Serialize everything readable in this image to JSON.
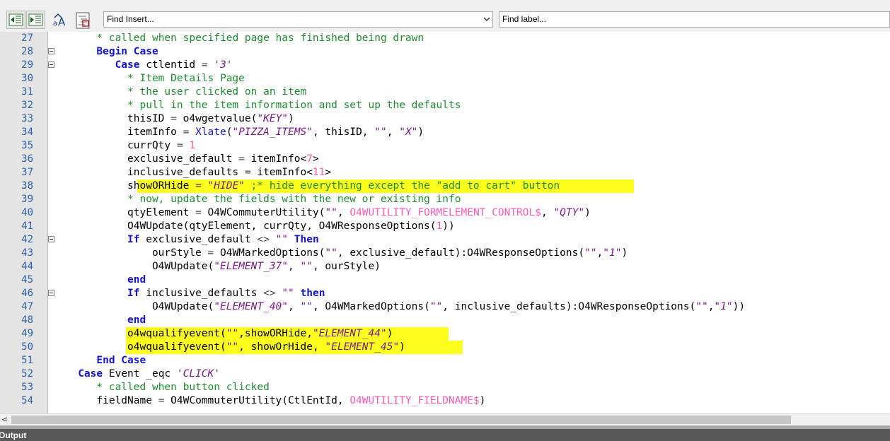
{
  "toolbar": {
    "find_insert_placeholder": "Find Insert...",
    "find_label_placeholder": "Find label...",
    "icons": [
      "outdent-icon",
      "indent-icon",
      "font-size-icon",
      "format-document-icon",
      "chevron-down-icon"
    ]
  },
  "colors": {
    "comment": "#1e8c2e",
    "keyword": "#1414d2",
    "string": "#7a1c88",
    "number": "#ff5ab4",
    "highlight": "#ffff1e",
    "line_number": "#2b5fb4"
  },
  "editor": {
    "lines": [
      {
        "n": "27",
        "fold": false,
        "tokens": [
          [
            "      ",
            ""
          ],
          [
            "* called when specified page has finished being drawn",
            "cm"
          ]
        ]
      },
      {
        "n": "28",
        "fold": true,
        "tokens": [
          [
            "      ",
            ""
          ],
          [
            "Begin Case",
            "kw"
          ]
        ]
      },
      {
        "n": "29",
        "fold": true,
        "tokens": [
          [
            "         ",
            ""
          ],
          [
            "Case",
            "kw"
          ],
          [
            " ctlentid ",
            ""
          ],
          [
            "=",
            "op"
          ],
          [
            " ",
            ""
          ],
          [
            "'3'",
            "str"
          ]
        ]
      },
      {
        "n": "30",
        "fold": false,
        "tokens": [
          [
            "           ",
            ""
          ],
          [
            "* Item Details Page",
            "cm"
          ]
        ]
      },
      {
        "n": "31",
        "fold": false,
        "tokens": [
          [
            "           ",
            ""
          ],
          [
            "* the user clicked on an item",
            "cm"
          ]
        ]
      },
      {
        "n": "32",
        "fold": false,
        "tokens": [
          [
            "           ",
            ""
          ],
          [
            "* pull in the item information and set up the defaults",
            "cm"
          ]
        ]
      },
      {
        "n": "33",
        "fold": false,
        "tokens": [
          [
            "           thisID ",
            ""
          ],
          [
            "=",
            "op"
          ],
          [
            " o4wgetvalue(",
            ""
          ],
          [
            "\"KEY\"",
            "str"
          ],
          [
            ")",
            ""
          ]
        ]
      },
      {
        "n": "34",
        "fold": false,
        "tokens": [
          [
            "           itemInfo ",
            ""
          ],
          [
            "=",
            "op"
          ],
          [
            " ",
            ""
          ],
          [
            "Xlate",
            "kw2"
          ],
          [
            "(",
            ""
          ],
          [
            "\"PIZZA_ITEMS\"",
            "str"
          ],
          [
            ", thisID, ",
            ""
          ],
          [
            "\"\"",
            "str"
          ],
          [
            ", ",
            ""
          ],
          [
            "\"X\"",
            "str"
          ],
          [
            ")",
            ""
          ]
        ]
      },
      {
        "n": "35",
        "fold": false,
        "tokens": [
          [
            "           currQty ",
            ""
          ],
          [
            "=",
            "op"
          ],
          [
            " ",
            ""
          ],
          [
            "1",
            "num"
          ]
        ]
      },
      {
        "n": "36",
        "fold": false,
        "tokens": [
          [
            "           exclusive_default ",
            ""
          ],
          [
            "=",
            "op"
          ],
          [
            " itemInfo<",
            ""
          ],
          [
            "7",
            "num"
          ],
          [
            ">",
            ""
          ]
        ]
      },
      {
        "n": "37",
        "fold": false,
        "tokens": [
          [
            "           inclusive_defaults ",
            ""
          ],
          [
            "=",
            "op"
          ],
          [
            " itemInfo<",
            ""
          ],
          [
            "11",
            "num"
          ],
          [
            ">",
            ""
          ]
        ]
      },
      {
        "n": "38",
        "fold": false,
        "hl": [
          194,
          896
        ],
        "tokens": [
          [
            "           showORHide ",
            ""
          ],
          [
            "=",
            "op"
          ],
          [
            " ",
            ""
          ],
          [
            "\"HIDE\"",
            "str"
          ],
          [
            " ",
            ""
          ],
          [
            ";* hide everything except the \"add to cart\" button",
            "cm"
          ]
        ]
      },
      {
        "n": "39",
        "fold": false,
        "tokens": [
          [
            "           ",
            ""
          ],
          [
            "* now, update the fields with the new or existing info",
            "cm"
          ]
        ]
      },
      {
        "n": "40",
        "fold": false,
        "tokens": [
          [
            "           qtyElement ",
            ""
          ],
          [
            "=",
            "op"
          ],
          [
            " O4WCommuterUtility(",
            ""
          ],
          [
            "\"\"",
            "str"
          ],
          [
            ", ",
            ""
          ],
          [
            "O4WUTILITY_FORMELEMENT_CONTROL$",
            "sys"
          ],
          [
            ", ",
            ""
          ],
          [
            "\"QTY\"",
            "str"
          ],
          [
            ")",
            ""
          ]
        ]
      },
      {
        "n": "41",
        "fold": false,
        "tokens": [
          [
            "           O4WUpdate(qtyElement, currQty, O4WResponseOptions(",
            ""
          ],
          [
            "1",
            "num"
          ],
          [
            "))",
            ""
          ]
        ]
      },
      {
        "n": "42",
        "fold": true,
        "tokens": [
          [
            "           ",
            ""
          ],
          [
            "If",
            "kw"
          ],
          [
            " exclusive_default ",
            ""
          ],
          [
            "<>",
            "op"
          ],
          [
            " ",
            ""
          ],
          [
            "\"\"",
            "str"
          ],
          [
            " ",
            ""
          ],
          [
            "Then",
            "kw"
          ]
        ]
      },
      {
        "n": "43",
        "fold": false,
        "tokens": [
          [
            "               ourStyle ",
            ""
          ],
          [
            "=",
            "op"
          ],
          [
            " O4WMarkedOptions(",
            ""
          ],
          [
            "\"\"",
            "str"
          ],
          [
            ", exclusive_default):O4WResponseOptions(",
            ""
          ],
          [
            "\"\"",
            "str"
          ],
          [
            ",",
            ""
          ],
          [
            "\"1\"",
            "str"
          ],
          [
            ")",
            ""
          ]
        ]
      },
      {
        "n": "44",
        "fold": false,
        "tokens": [
          [
            "               O4WUpdate(",
            ""
          ],
          [
            "\"ELEMENT_37\"",
            "str"
          ],
          [
            ", ",
            ""
          ],
          [
            "\"\"",
            "str"
          ],
          [
            ", ourStyle)",
            ""
          ]
        ]
      },
      {
        "n": "45",
        "fold": false,
        "tokens": [
          [
            "           ",
            ""
          ],
          [
            "end",
            "kw"
          ]
        ]
      },
      {
        "n": "46",
        "fold": true,
        "tokens": [
          [
            "           ",
            ""
          ],
          [
            "If",
            "kw"
          ],
          [
            " inclusive_defaults ",
            ""
          ],
          [
            "<>",
            "op"
          ],
          [
            " ",
            ""
          ],
          [
            "\"\"",
            "str"
          ],
          [
            " ",
            ""
          ],
          [
            "then",
            "kw"
          ]
        ]
      },
      {
        "n": "47",
        "fold": false,
        "tokens": [
          [
            "               O4WUpdate(",
            ""
          ],
          [
            "\"ELEMENT_40\"",
            "str"
          ],
          [
            ", ",
            ""
          ],
          [
            "\"\"",
            "str"
          ],
          [
            ", O4WMarkedOptions(",
            ""
          ],
          [
            "\"\"",
            "str"
          ],
          [
            ", inclusive_defaults):O4WResponseOptions(",
            ""
          ],
          [
            "\"\"",
            "str"
          ],
          [
            ",",
            ""
          ],
          [
            "\"1\"",
            "str"
          ],
          [
            "))",
            ""
          ]
        ]
      },
      {
        "n": "48",
        "fold": false,
        "tokens": [
          [
            "           ",
            ""
          ],
          [
            "end",
            "kw"
          ]
        ]
      },
      {
        "n": "49",
        "fold": false,
        "hl": [
          178,
          634
        ],
        "tokens": [
          [
            "           o4wqualifyevent(",
            ""
          ],
          [
            "\"\"",
            "str"
          ],
          [
            ",showORHide,",
            ""
          ],
          [
            "\"ELEMENT_44\"",
            "str"
          ],
          [
            ")",
            ""
          ]
        ]
      },
      {
        "n": "50",
        "fold": false,
        "hl": [
          178,
          654
        ],
        "tokens": [
          [
            "           o4wqualifyevent(",
            ""
          ],
          [
            "\"\"",
            "str"
          ],
          [
            ", showOrHide, ",
            ""
          ],
          [
            "\"ELEMENT_45\"",
            "str"
          ],
          [
            ")",
            ""
          ]
        ]
      },
      {
        "n": "51",
        "fold": false,
        "tokens": [
          [
            "      ",
            ""
          ],
          [
            "End Case",
            "kw"
          ]
        ]
      },
      {
        "n": "52",
        "fold": false,
        "tokens": [
          [
            "   ",
            ""
          ],
          [
            "Case",
            "kw"
          ],
          [
            " Event _eqc ",
            ""
          ],
          [
            "'CLICK'",
            "str"
          ]
        ]
      },
      {
        "n": "53",
        "fold": false,
        "tokens": [
          [
            "      ",
            ""
          ],
          [
            "* called when button clicked",
            "cm"
          ]
        ]
      },
      {
        "n": "54",
        "fold": false,
        "tokens": [
          [
            "      fieldName ",
            ""
          ],
          [
            "=",
            "op"
          ],
          [
            " O4WCommuterUtility(CtlEntId, ",
            ""
          ],
          [
            "O4WUTILITY_FIELDNAME$",
            "sys"
          ],
          [
            ")",
            ""
          ]
        ]
      }
    ]
  },
  "output_panel": {
    "title": "Output"
  }
}
